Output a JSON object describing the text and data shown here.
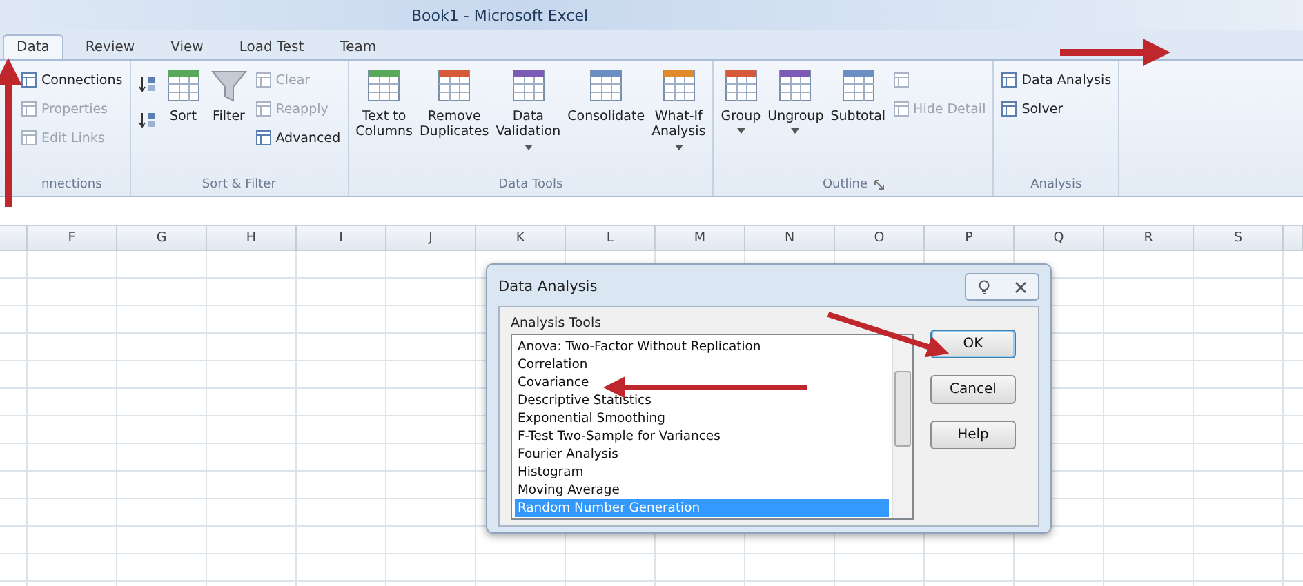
{
  "window": {
    "title": "Book1 - Microsoft Excel"
  },
  "tabs": [
    {
      "label": "Data",
      "selected": true
    },
    {
      "label": "Review",
      "selected": false
    },
    {
      "label": "View",
      "selected": false
    },
    {
      "label": "Load Test",
      "selected": false
    },
    {
      "label": "Team",
      "selected": false
    }
  ],
  "ribbon": {
    "groups": [
      {
        "label": "nnections",
        "items": [
          {
            "kind": "stack",
            "entries": [
              {
                "label": "Connections",
                "disabled": false
              },
              {
                "label": "Properties",
                "disabled": true
              },
              {
                "label": "Edit Links",
                "disabled": true
              }
            ]
          }
        ]
      },
      {
        "label": "Sort & Filter",
        "items": [
          {
            "kind": "iconstack"
          },
          {
            "kind": "large",
            "label": "Sort",
            "disabled": false
          },
          {
            "kind": "large",
            "label": "Filter",
            "disabled": false
          },
          {
            "kind": "stack",
            "entries": [
              {
                "label": "Clear",
                "disabled": true
              },
              {
                "label": "Reapply",
                "disabled": true
              },
              {
                "label": "Advanced",
                "disabled": false
              }
            ]
          }
        ]
      },
      {
        "label": "Data Tools",
        "items": [
          {
            "kind": "large",
            "label": "Text to\nColumns",
            "disabled": false
          },
          {
            "kind": "large",
            "label": "Remove\nDuplicates",
            "disabled": false
          },
          {
            "kind": "large",
            "label": "Data\nValidation",
            "dropdown": true,
            "disabled": false
          },
          {
            "kind": "large",
            "label": "Consolidate",
            "disabled": false
          },
          {
            "kind": "large",
            "label": "What-If\nAnalysis",
            "dropdown": true,
            "disabled": false
          }
        ]
      },
      {
        "label": "Outline",
        "launcher": true,
        "items": [
          {
            "kind": "large",
            "label": "Group",
            "dropdown": true,
            "disabled": false
          },
          {
            "kind": "large",
            "label": "Ungroup",
            "dropdown": true,
            "disabled": false
          },
          {
            "kind": "large",
            "label": "Subtotal",
            "disabled": false
          },
          {
            "kind": "stack",
            "entries": [
              {
                "disabled": true
              },
              {
                "label": "Hide Detail",
                "disabled": true
              }
            ]
          }
        ]
      },
      {
        "label": "Analysis",
        "items": [
          {
            "kind": "stack",
            "entries": [
              {
                "label": "Data Analysis",
                "disabled": false
              },
              {
                "label": "Solver",
                "disabled": false
              }
            ]
          }
        ]
      }
    ]
  },
  "sheet": {
    "columns": [
      "F",
      "G",
      "H",
      "I",
      "J",
      "K",
      "L",
      "M",
      "N",
      "O",
      "P",
      "Q",
      "R",
      "S"
    ]
  },
  "dialog": {
    "title": "Data Analysis",
    "list_label": "Analysis Tools",
    "items": [
      {
        "label": "Anova: Two-Factor Without Replication",
        "selected": false
      },
      {
        "label": "Correlation",
        "selected": false
      },
      {
        "label": "Covariance",
        "selected": false
      },
      {
        "label": "Descriptive Statistics",
        "selected": false
      },
      {
        "label": "Exponential Smoothing",
        "selected": false
      },
      {
        "label": "F-Test Two-Sample for Variances",
        "selected": false
      },
      {
        "label": "Fourier Analysis",
        "selected": false
      },
      {
        "label": "Histogram",
        "selected": false
      },
      {
        "label": "Moving Average",
        "selected": false
      },
      {
        "label": "Random Number Generation",
        "selected": true
      }
    ],
    "buttons": [
      {
        "label": "OK",
        "default": true
      },
      {
        "label": "Cancel",
        "default": false
      },
      {
        "label": "Help",
        "default": false
      }
    ]
  }
}
